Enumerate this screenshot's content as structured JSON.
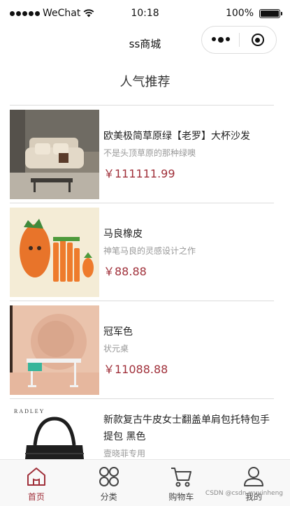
{
  "status_bar": {
    "carrier": "WeChat",
    "time": "10:18",
    "battery": "100%"
  },
  "nav": {
    "title": "ss商城"
  },
  "section": {
    "title": "人气推荐"
  },
  "products": [
    {
      "name": "欧美极简草原绿【老罗】大杯沙发",
      "desc": "不是头顶草原的那种绿噢",
      "price": "￥111111.99"
    },
    {
      "name": "马良橡皮",
      "desc": "神笔马良的灵感设计之作",
      "price": "￥88.88"
    },
    {
      "name": "冠军色",
      "desc": "状元桌",
      "price": "￥11088.88"
    },
    {
      "name": "新款复古牛皮女士翻盖单肩包托特包手提包 黑色",
      "desc": "壹晓菲专用",
      "image_text": "RADLEY"
    }
  ],
  "tabs": [
    {
      "label": "首页",
      "icon": "home-icon",
      "active": true
    },
    {
      "label": "分类",
      "icon": "category-icon",
      "active": false
    },
    {
      "label": "购物车",
      "icon": "cart-icon",
      "active": false
    },
    {
      "label": "我的",
      "icon": "user-icon",
      "active": false
    }
  ],
  "watermark": "CSDN @csdn-wuyinheng",
  "colors": {
    "accent": "#a0303a",
    "divider": "#dcdcdc",
    "tab_bg": "#f8f8f8"
  }
}
